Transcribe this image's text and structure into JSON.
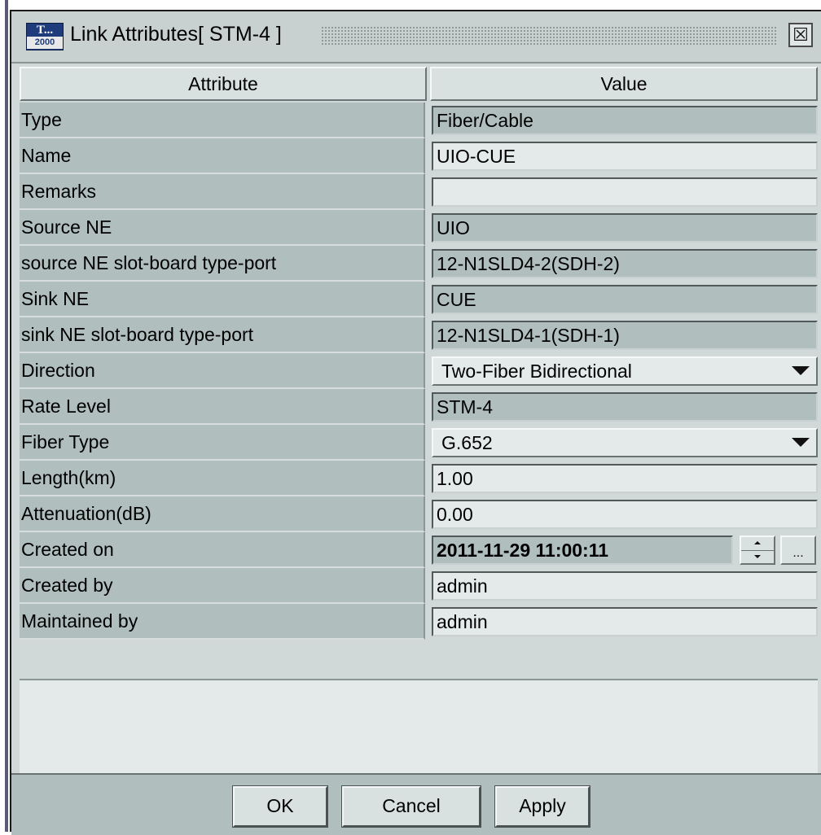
{
  "window": {
    "logo_top": "T...",
    "logo_bottom": "2000",
    "title": "Link Attributes[ STM-4 ]",
    "close_glyph": "☒"
  },
  "table": {
    "headers": {
      "attribute": "Attribute",
      "value": "Value"
    },
    "rows": [
      {
        "attribute": "Type",
        "value": "Fiber/Cable",
        "kind": "readonly"
      },
      {
        "attribute": "Name",
        "value": "UIO-CUE",
        "kind": "editable"
      },
      {
        "attribute": "Remarks",
        "value": "",
        "kind": "editable"
      },
      {
        "attribute": "Source NE",
        "value": "UIO",
        "kind": "readonly"
      },
      {
        "attribute": "source NE slot-board type-port",
        "value": "12-N1SLD4-2(SDH-2)",
        "kind": "readonly"
      },
      {
        "attribute": "Sink NE",
        "value": "CUE",
        "kind": "readonly"
      },
      {
        "attribute": "sink NE slot-board type-port",
        "value": "12-N1SLD4-1(SDH-1)",
        "kind": "readonly"
      },
      {
        "attribute": "Direction",
        "value": "Two-Fiber Bidirectional",
        "kind": "dropdown"
      },
      {
        "attribute": "Rate Level",
        "value": "STM-4",
        "kind": "readonly"
      },
      {
        "attribute": "Fiber Type",
        "value": "G.652",
        "kind": "dropdown"
      },
      {
        "attribute": "Length(km)",
        "value": "1.00",
        "kind": "editable"
      },
      {
        "attribute": "Attenuation(dB)",
        "value": "0.00",
        "kind": "editable"
      },
      {
        "attribute": "Created on",
        "value": "2011-11-29 11:00:11",
        "kind": "datetime",
        "picker_label": "..."
      },
      {
        "attribute": "Created by",
        "value": "admin",
        "kind": "editable"
      },
      {
        "attribute": "Maintained by",
        "value": "admin",
        "kind": "editable"
      }
    ]
  },
  "buttons": {
    "ok": "OK",
    "cancel": "Cancel",
    "apply": "Apply"
  },
  "colors": {
    "window_bg": "#d0d8d8",
    "readonly_bg": "#b0bebe",
    "editable_bg": "#e4eaea",
    "logo_blue": "#1e3c7c"
  }
}
